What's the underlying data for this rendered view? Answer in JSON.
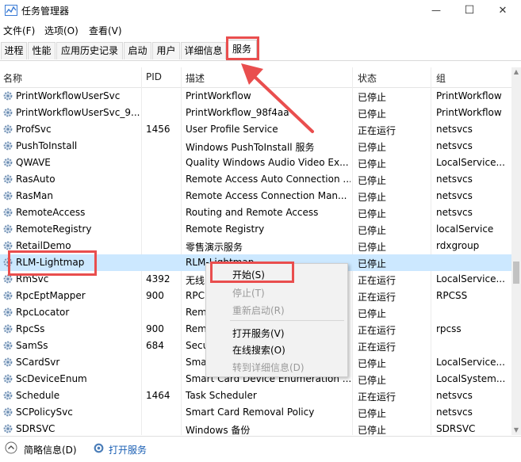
{
  "window": {
    "title": "任务管理器",
    "minimize": "—",
    "maximize": "☐",
    "close": "✕"
  },
  "menu": [
    "文件(F)",
    "选项(O)",
    "查看(V)"
  ],
  "tabs": [
    "进程",
    "性能",
    "应用历史记录",
    "启动",
    "用户",
    "详细信息",
    "服务"
  ],
  "active_tab": "服务",
  "columns": [
    "名称",
    "PID",
    "描述",
    "状态",
    "组"
  ],
  "rows": [
    {
      "name": "PrintWorkflowUserSvc",
      "pid": "",
      "desc": "PrintWorkflow",
      "status": "已停止",
      "group": "PrintWorkflow"
    },
    {
      "name": "PrintWorkflowUserSvc_9...",
      "pid": "",
      "desc": "PrintWorkflow_98f4aa",
      "status": "已停止",
      "group": "PrintWorkflow"
    },
    {
      "name": "ProfSvc",
      "pid": "1456",
      "desc": "User Profile Service",
      "status": "正在运行",
      "group": "netsvcs"
    },
    {
      "name": "PushToInstall",
      "pid": "",
      "desc": "Windows PushToInstall 服务",
      "status": "已停止",
      "group": "netsvcs"
    },
    {
      "name": "QWAVE",
      "pid": "",
      "desc": "Quality Windows Audio Video Ex...",
      "status": "已停止",
      "group": "LocalService..."
    },
    {
      "name": "RasAuto",
      "pid": "",
      "desc": "Remote Access Auto Connection ...",
      "status": "已停止",
      "group": "netsvcs"
    },
    {
      "name": "RasMan",
      "pid": "",
      "desc": "Remote Access Connection Man...",
      "status": "已停止",
      "group": "netsvcs"
    },
    {
      "name": "RemoteAccess",
      "pid": "",
      "desc": "Routing and Remote Access",
      "status": "已停止",
      "group": "netsvcs"
    },
    {
      "name": "RemoteRegistry",
      "pid": "",
      "desc": "Remote Registry",
      "status": "已停止",
      "group": "localService"
    },
    {
      "name": "RetailDemo",
      "pid": "",
      "desc": "零售演示服务",
      "status": "已停止",
      "group": "rdxgroup"
    },
    {
      "name": "RLM-Lightmap",
      "pid": "",
      "desc": "RLM-Lightmap",
      "status": "已停止",
      "group": ""
    },
    {
      "name": "RmSvc",
      "pid": "4392",
      "desc": "无线...",
      "status": "正在运行",
      "group": "LocalService..."
    },
    {
      "name": "RpcEptMapper",
      "pid": "900",
      "desc": "RPC...",
      "status": "正在运行",
      "group": "RPCSS"
    },
    {
      "name": "RpcLocator",
      "pid": "",
      "desc": "Rem...",
      "status": "已停止",
      "group": ""
    },
    {
      "name": "RpcSs",
      "pid": "900",
      "desc": "Rem...",
      "status": "正在运行",
      "group": "rpcss"
    },
    {
      "name": "SamSs",
      "pid": "684",
      "desc": "Secu...",
      "status": "正在运行",
      "group": ""
    },
    {
      "name": "SCardSvr",
      "pid": "",
      "desc": "Sma...",
      "status": "已停止",
      "group": "LocalService..."
    },
    {
      "name": "ScDeviceEnum",
      "pid": "",
      "desc": "Smart Card Device Enumeration ...",
      "status": "已停止",
      "group": "LocalSystem..."
    },
    {
      "name": "Schedule",
      "pid": "1464",
      "desc": "Task Scheduler",
      "status": "正在运行",
      "group": "netsvcs"
    },
    {
      "name": "SCPolicySvc",
      "pid": "",
      "desc": "Smart Card Removal Policy",
      "status": "已停止",
      "group": "netsvcs"
    },
    {
      "name": "SDRSVC",
      "pid": "",
      "desc": "Windows 备份",
      "status": "已停止",
      "group": "SDRSVC"
    }
  ],
  "context_menu": [
    {
      "label": "开始(S)",
      "enabled": true
    },
    {
      "label": "停止(T)",
      "enabled": false
    },
    {
      "label": "重新启动(R)",
      "enabled": false
    },
    {
      "label": "打开服务(V)",
      "enabled": true
    },
    {
      "label": "在线搜索(O)",
      "enabled": true
    },
    {
      "label": "转到详细信息(D)",
      "enabled": false
    }
  ],
  "footer": {
    "summary": "简略信息(D)",
    "open_services": "打开服务"
  },
  "colors": {
    "selected_row": "#cce8ff",
    "highlight": "#e94e4e",
    "link": "#1a5fb4"
  }
}
